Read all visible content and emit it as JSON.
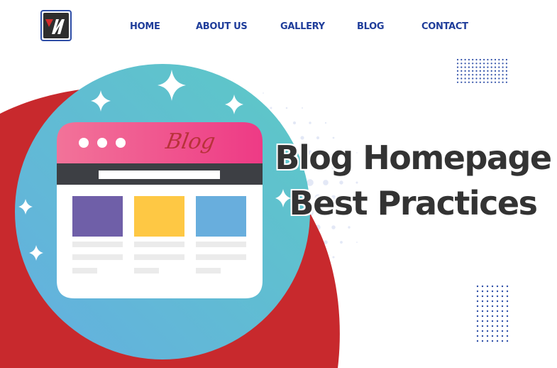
{
  "logo": {
    "name": "W logo",
    "icon": "w-logo-icon"
  },
  "nav": {
    "items": [
      {
        "label": "HOME"
      },
      {
        "label": "ABOUT US"
      },
      {
        "label": "GALLERY"
      },
      {
        "label": "BLOG"
      },
      {
        "label": "CONTACT"
      }
    ]
  },
  "hero": {
    "title_line1": "Blog Homepage",
    "title_line2": "Best Practices",
    "illustration": {
      "browser_title": "Blog",
      "card_colors": [
        "#6f5fa8",
        "#fec844",
        "#68aedd"
      ]
    }
  },
  "colors": {
    "nav_text": "#1f3d9a",
    "red_blob": "#c8292d",
    "teal_circle": "#5dc6c9",
    "browser_header": "#ee3f85",
    "browser_bar": "#3d3f44",
    "title_text": "#333333",
    "dot_pattern": "#2f4fa8"
  }
}
